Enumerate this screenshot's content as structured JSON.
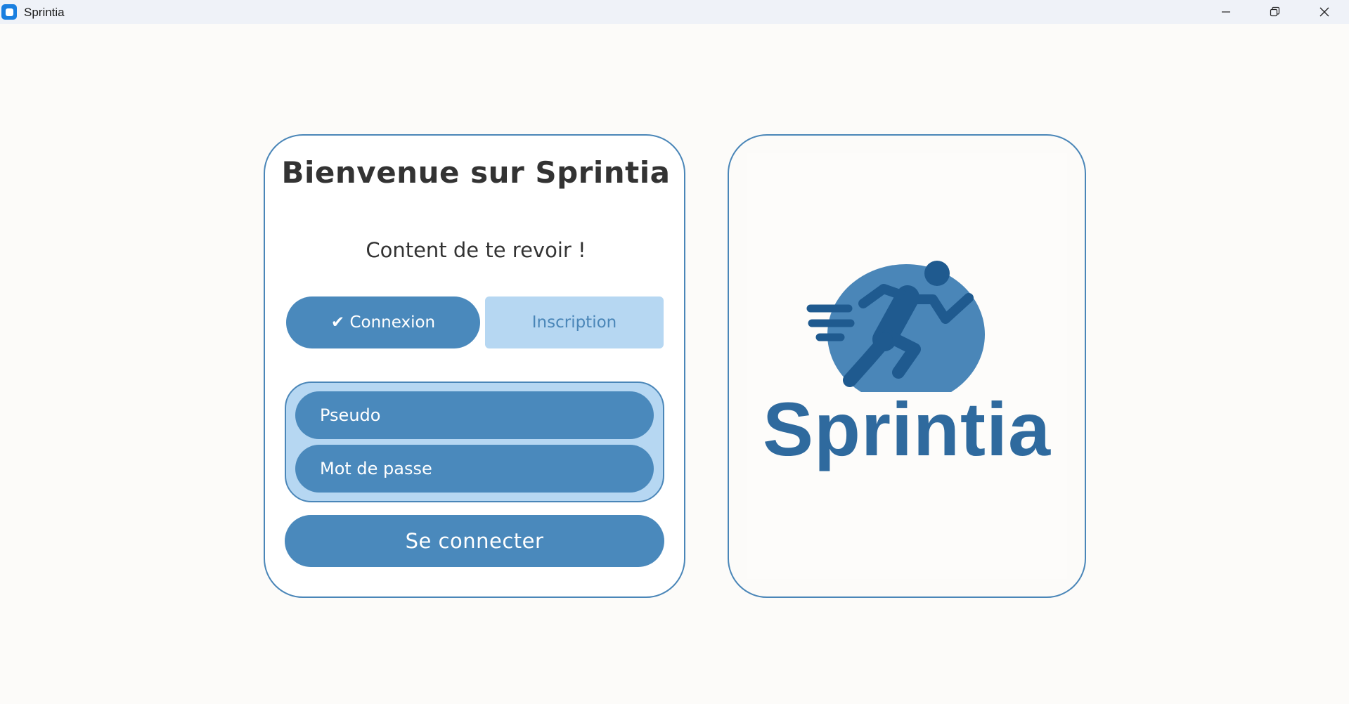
{
  "window": {
    "title": "Sprintia",
    "controls": [
      "minimize-icon",
      "restore-icon",
      "close-icon"
    ]
  },
  "login": {
    "title": "Bienvenue sur Sprintia",
    "subtitle": "Content de te revoir !",
    "tabs": [
      {
        "label": "✔ Connexion",
        "active": true
      },
      {
        "label": "Inscription",
        "active": false
      }
    ],
    "username_placeholder": "Pseudo",
    "password_placeholder": "Mot de passe",
    "submit_label": "Se connecter"
  },
  "logo": {
    "wordmark": "Sprintia",
    "icon": "runner-icon"
  },
  "colors": {
    "accent": "#4a89bc",
    "accent_light": "#b6d7f2",
    "logo_blue": "#2f6a9e",
    "logo_circle": "#4a86b8",
    "border": "#4a86b8",
    "text_dark": "#333333",
    "background": "#fcfbf9"
  }
}
